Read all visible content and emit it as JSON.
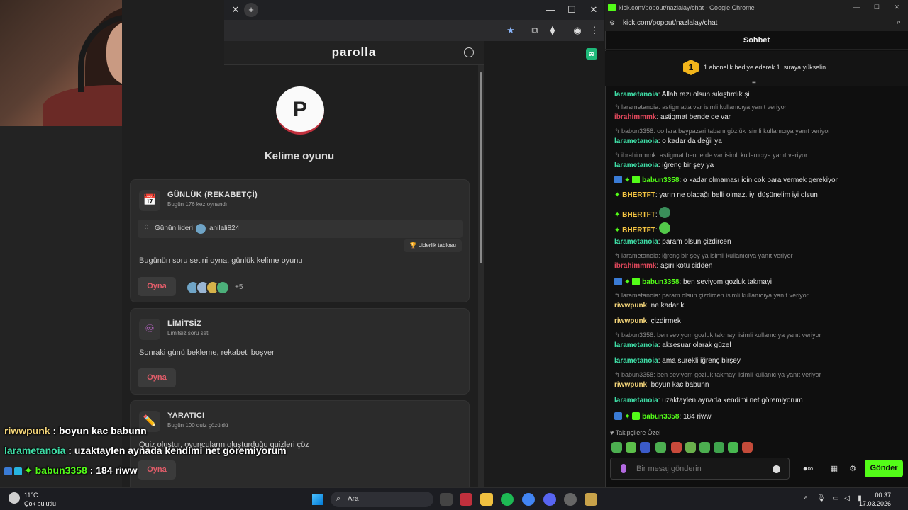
{
  "browser": {
    "tab_close": "✕",
    "tab_new": "+",
    "win_min": "—",
    "win_max": "☐",
    "win_close": "✕"
  },
  "parolla": {
    "logo": "parolla",
    "avatar_letter": "P",
    "title": "Kelime oyunu",
    "cards": [
      {
        "icon": "📅",
        "title": "GÜNLÜK (REKABETÇİ)",
        "sub": "Bugün 176 kez oynandı",
        "leader_label": "Günün lideri",
        "leader_name": "anilali824",
        "leaderboard": "🏆 Liderlik tablosu",
        "desc": "Bugünün soru setini oyna, günlük kelime oyunu",
        "play": "Oyna",
        "plus": "+5"
      },
      {
        "icon": "♾",
        "title": "LİMİTSİZ",
        "sub": "Limitsiz soru seti",
        "desc": "Sonraki günü bekleme, rekabeti boşver",
        "play": "Oyna"
      },
      {
        "icon": "✏️",
        "title": "YARATICI",
        "sub": "Bugün 100 quiz çözüldü",
        "desc": "Quiz oluştur, oyuncuların oluşturduğu quizleri çöz",
        "play": "Oyna"
      }
    ]
  },
  "overlay": [
    {
      "user": "riwwpunk",
      "text": " : boyun kac babunn",
      "color": "#f5d67a"
    },
    {
      "user": "larametanoia",
      "text": " : uzaktaylen aynada kendimi net göremiyorum",
      "color": "#3fe0a8"
    },
    {
      "user": "babun3358",
      "text": " : 184 riww",
      "color": "#53fc18"
    }
  ],
  "chat": {
    "window_title": "kick.com/popout/nazlalay/chat - Google Chrome",
    "url": "kick.com/popout/nazlalay/chat",
    "header": "Sohbet",
    "sub_rank": "1",
    "sub_text": "1 abonelik hediye ederek 1. sıraya yükselin",
    "messages": [
      {
        "type": "msg",
        "user": "larametanoia",
        "color": "#3fe0a8",
        "text": ": Allah razı olsun sıkıştırdık şi"
      },
      {
        "type": "reply",
        "text": "↰ larametanoia: astigmatta var isimli kullanıcıya yanıt veriyor"
      },
      {
        "type": "msg",
        "user": "ibrahimmmk",
        "color": "#e0475b",
        "text": ": astigmat bende de var"
      },
      {
        "type": "reply",
        "text": "↰ babun3358: oo lara beypazari tabanı gözlük isimli kullanıcıya yanıt veriyor"
      },
      {
        "type": "msg",
        "user": "larametanoia",
        "color": "#3fe0a8",
        "text": ": o kadar da değil ya"
      },
      {
        "type": "reply",
        "text": "↰ ibrahimmmk: astigmat bende de var isimli kullanıcıya yanıt veriyor"
      },
      {
        "type": "msg",
        "user": "larametanoia",
        "color": "#3fe0a8",
        "text": ": iğrenç bir şey ya"
      },
      {
        "type": "msg",
        "badges": true,
        "user": "babun3358",
        "color": "#53fc18",
        "text": ": o kadar olmaması icin cok para vermek gerekiyor"
      },
      {
        "type": "msg",
        "star": true,
        "user": "BHERTFT",
        "color": "#f5c542",
        "text": ": yarın ne olacağı belli olmaz. iyi düşünelim iyi olsun"
      },
      {
        "type": "msg",
        "star": true,
        "user": "BHERTFT",
        "color": "#f5c542",
        "text": ": "
      },
      {
        "type": "msg",
        "star": true,
        "user": "BHERTFT",
        "color": "#f5c542",
        "text": ": "
      },
      {
        "type": "msg",
        "user": "larametanoia",
        "color": "#3fe0a8",
        "text": ": param olsun çizdircen"
      },
      {
        "type": "reply",
        "text": "↰ larametanoia: iğrenç bir şey ya isimli kullanıcıya yanıt veriyor"
      },
      {
        "type": "msg",
        "user": "ibrahimmmk",
        "color": "#e0475b",
        "text": ": aşırı kötü cidden"
      },
      {
        "type": "msg",
        "badges": true,
        "user": "babun3358",
        "color": "#53fc18",
        "text": ": ben seviyom gozluk takmayi"
      },
      {
        "type": "reply",
        "text": "↰ larametanoia: param olsun çizdircen isimli kullanıcıya yanıt veriyor"
      },
      {
        "type": "msg",
        "user": "riwwpunk",
        "color": "#f5d67a",
        "text": ": ne kadar ki"
      },
      {
        "type": "msg",
        "user": "riwwpunk",
        "color": "#f5d67a",
        "text": ": çizdirmek"
      },
      {
        "type": "reply",
        "text": "↰ babun3358: ben seviyom gozluk takmayi isimli kullanıcıya yanıt veriyor"
      },
      {
        "type": "msg",
        "user": "larametanoia",
        "color": "#3fe0a8",
        "text": ": aksesuar olarak güzel"
      },
      {
        "type": "msg",
        "user": "larametanoia",
        "color": "#3fe0a8",
        "text": ": ama sürekli iğrenç birşey"
      },
      {
        "type": "reply",
        "text": "↰ babun3358: ben seviyom gozluk takmayi isimli kullanıcıya yanıt veriyor"
      },
      {
        "type": "msg",
        "user": "riwwpunk",
        "color": "#f5d67a",
        "text": ": boyun kac babunn"
      },
      {
        "type": "msg",
        "user": "larametanoia",
        "color": "#3fe0a8",
        "text": ": uzaktaylen aynada kendimi net göremiyorum"
      },
      {
        "type": "msg",
        "badges": true,
        "user": "babun3358",
        "color": "#53fc18",
        "text": ": 184 riww"
      }
    ],
    "followers_label": "♥ Takipçilere Özel",
    "input_placeholder": "Bir mesaj gönderin",
    "send": "Gönder"
  },
  "taskbar": {
    "temp": "11°C",
    "weather": "Çok bulutlu",
    "search": "Ara",
    "time": "00:37",
    "date": "17.03.2026"
  },
  "colors": {
    "kick_green": "#53fc18",
    "play_red": "#e35d6a"
  }
}
